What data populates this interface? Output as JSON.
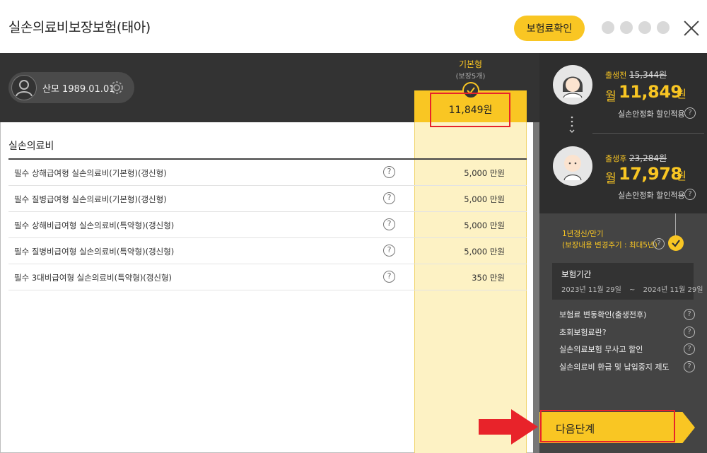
{
  "header": {
    "title": "실손의료비보장보험(태아)",
    "confirm_label": "보험료확인"
  },
  "profile": {
    "name": "산모 1989.01.01"
  },
  "plan": {
    "name": "기본형",
    "sub": "(보장5개)",
    "price": "11,849원"
  },
  "section": {
    "title": "실손의료비"
  },
  "rows": [
    {
      "label": "필수 상해급여형 실손의료비(기본형)(갱신형)",
      "value": "5,000 만원"
    },
    {
      "label": "필수 질병급여형 실손의료비(기본형)(갱신형)",
      "value": "5,000 만원"
    },
    {
      "label": "필수 상해비급여형 실손의료비(특약형)(갱신형)",
      "value": "5,000 만원"
    },
    {
      "label": "필수 질병비급여형 실손의료비(특약형)(갱신형)",
      "value": "5,000 만원"
    },
    {
      "label": "필수 3대비급여형 실손의료비(특약형)(갱신형)",
      "value": "350 만원"
    }
  ],
  "before_birth": {
    "label": "출생전",
    "old_price": "15,344원",
    "month": "월",
    "price": "11,849",
    "won": "원",
    "discount": "실손안정화 할인적용"
  },
  "after_birth": {
    "label": "출생후",
    "old_price": "23,284원",
    "month": "월",
    "price": "17,978",
    "won": "원",
    "discount": "실손안정화 할인적용"
  },
  "renewal": {
    "line1": "1년갱신/만기",
    "line2": "(보장내용 변경주기 : 최대5년)"
  },
  "period": {
    "title": "보험기간",
    "start": "2023년 11월 29일",
    "sep": "~",
    "end": "2024년 11월 29일"
  },
  "links": [
    "보험료 변동확인(출생전후)",
    "초회보험료란?",
    "실손의료보험 무사고 할인",
    "실손의료비 환급 및 납입중지 제도"
  ],
  "next_label": "다음단계",
  "colors": {
    "accent": "#f9c623",
    "dark": "#333333",
    "highlight": "#e8232a"
  }
}
